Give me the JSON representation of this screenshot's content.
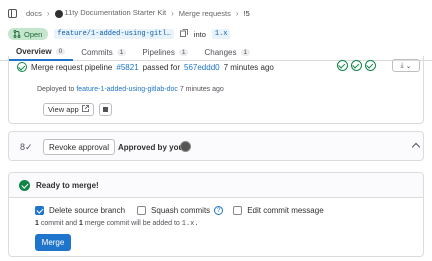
{
  "breadcrumb": {
    "items": [
      "docs",
      "11ty Documentation Starter Kit",
      "Merge requests",
      "!5"
    ]
  },
  "header": {
    "status": "Open",
    "source_branch": "feature/1-added-using-gitl…",
    "into_label": "into",
    "target_branch": "1.x"
  },
  "tabs": [
    {
      "label": "Overview",
      "count": "0"
    },
    {
      "label": "Commits",
      "count": "1"
    },
    {
      "label": "Pipelines",
      "count": "1"
    },
    {
      "label": "Changes",
      "count": "1"
    }
  ],
  "pipeline": {
    "prefix": "Merge request pipeline",
    "id": "#5821",
    "status_text": "passed for",
    "commit": "567eddd0",
    "time": "7 minutes ago",
    "deployed_prefix": "Deployed to",
    "environment": "feature-1-added-using-gitlab-doc",
    "deployed_time": "7 minutes ago",
    "view_app_label": "View app"
  },
  "approval": {
    "revoke_label": "Revoke approval",
    "approved_text": "Approved by you"
  },
  "merge": {
    "ready_text": "Ready to merge!",
    "options": [
      {
        "label": "Delete source branch",
        "checked": true
      },
      {
        "label": "Squash commits",
        "checked": false
      },
      {
        "label": "Edit commit message",
        "checked": false
      }
    ],
    "note_count1": "1",
    "note_text1": "commit and",
    "note_count2": "1",
    "note_text2": "merge commit will be added to",
    "note_branch": "1.x.",
    "merge_label": "Merge"
  },
  "colors": {
    "success": "#108548",
    "primary": "#1f75cb",
    "open_badge_bg": "#c3e6cd"
  }
}
